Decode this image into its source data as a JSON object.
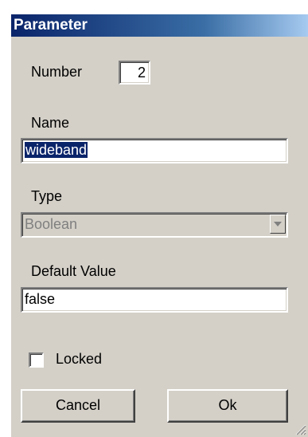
{
  "window": {
    "title": "Parameter"
  },
  "number": {
    "label": "Number",
    "value": "2"
  },
  "name": {
    "label": "Name",
    "value": "wideband"
  },
  "type": {
    "label": "Type",
    "value": "Boolean"
  },
  "default_value": {
    "label": "Default Value",
    "value": "false"
  },
  "locked": {
    "label": "Locked",
    "checked": false
  },
  "buttons": {
    "cancel": "Cancel",
    "ok": "Ok"
  },
  "colors": {
    "title_bar_start": "#0a246a",
    "title_bar_end": "#a6caf0",
    "dialog_face": "#d4d0c8",
    "selection": "#0a246a"
  }
}
